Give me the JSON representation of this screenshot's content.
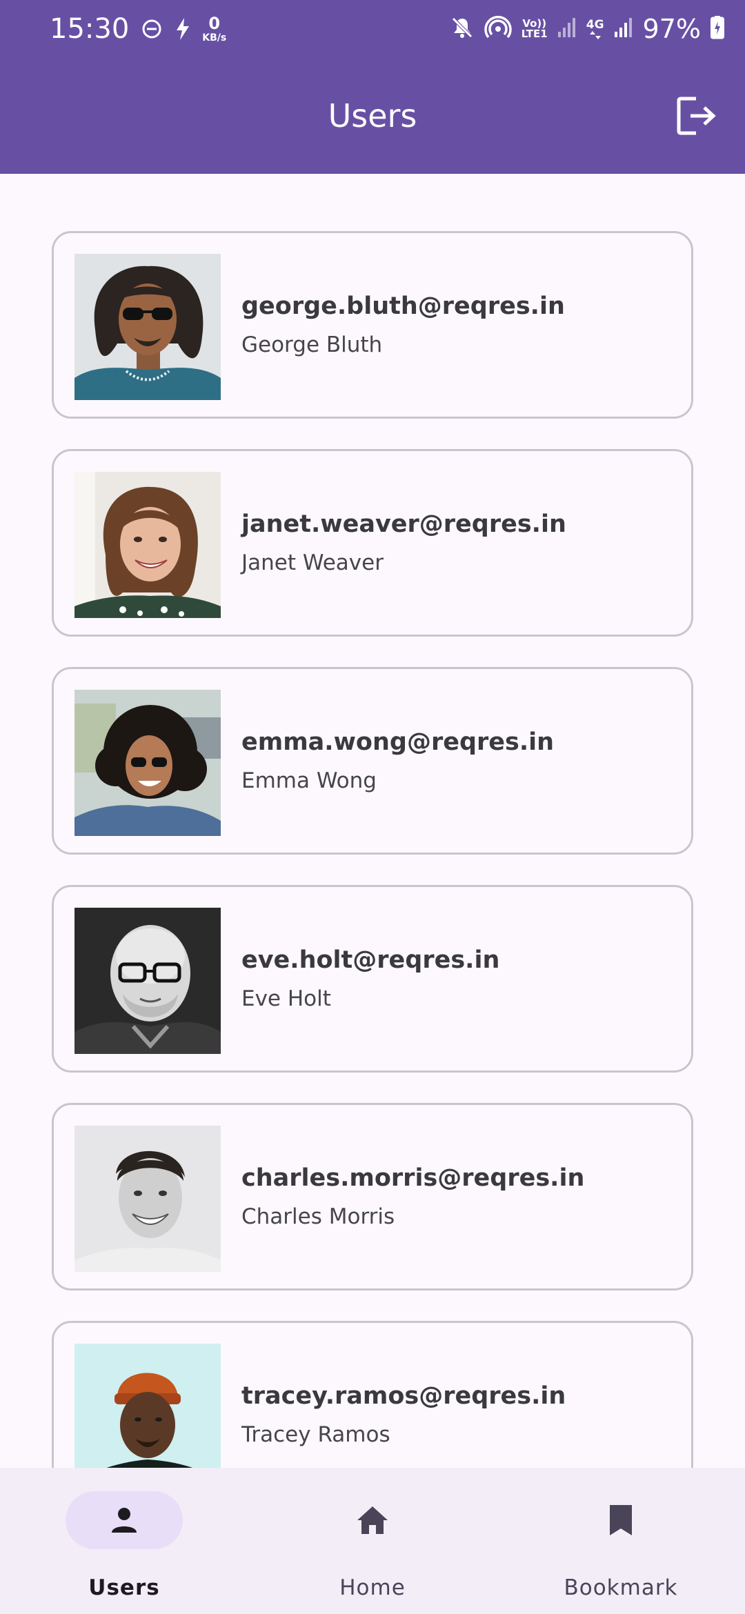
{
  "status_bar": {
    "time": "15:30",
    "speed_value": "0",
    "speed_unit": "KB/s",
    "volte_top": "Vo))",
    "volte_bottom": "LTE1",
    "network": "4G",
    "battery": "97%",
    "icons": [
      "dnd-icon",
      "charging-bolt-icon",
      "mute-icon",
      "hotspot-icon",
      "signal-icon",
      "battery-icon"
    ]
  },
  "app_bar": {
    "title": "Users",
    "logout_icon": "logout-icon"
  },
  "users": [
    {
      "email": "george.bluth@reqres.in",
      "name": "George Bluth"
    },
    {
      "email": "janet.weaver@reqres.in",
      "name": "Janet Weaver"
    },
    {
      "email": "emma.wong@reqres.in",
      "name": "Emma Wong"
    },
    {
      "email": "eve.holt@reqres.in",
      "name": "Eve Holt"
    },
    {
      "email": "charles.morris@reqres.in",
      "name": "Charles Morris"
    },
    {
      "email": "tracey.ramos@reqres.in",
      "name": "Tracey Ramos"
    }
  ],
  "bottom_nav": {
    "items": [
      {
        "label": "Users",
        "icon": "person-icon",
        "active": true
      },
      {
        "label": "Home",
        "icon": "home-icon",
        "active": false
      },
      {
        "label": "Bookmark",
        "icon": "bookmark-icon",
        "active": false
      }
    ]
  },
  "colors": {
    "primary": "#6750a4",
    "card_border": "#cac4cf",
    "nav_background": "#f3edf7",
    "active_indicator": "#e8def8"
  }
}
